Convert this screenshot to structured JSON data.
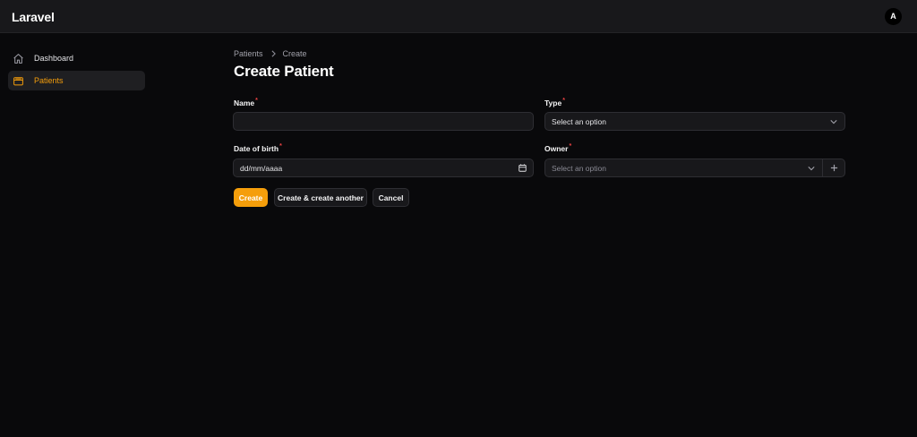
{
  "app": {
    "brand": "Laravel",
    "avatar_initial": "A"
  },
  "sidebar": {
    "items": [
      {
        "label": "Dashboard",
        "icon": "home-icon",
        "active": false
      },
      {
        "label": "Patients",
        "icon": "wallet-icon",
        "active": true
      }
    ]
  },
  "breadcrumb": {
    "parent": "Patients",
    "current": "Create"
  },
  "page": {
    "title": "Create Patient"
  },
  "form": {
    "name": {
      "label": "Name",
      "required_mark": "*",
      "value": ""
    },
    "type": {
      "label": "Type",
      "required_mark": "*",
      "value": "Select an option"
    },
    "date_of_birth": {
      "label": "Date of birth",
      "required_mark": "*",
      "placeholder": "dd/mm/aaaa"
    },
    "owner": {
      "label": "Owner",
      "required_mark": "*",
      "placeholder": "Select an option"
    }
  },
  "actions": {
    "create": "Create",
    "create_another": "Create & create another",
    "cancel": "Cancel"
  },
  "colors": {
    "accent": "#f59e0b",
    "background": "#09090b",
    "topbar": "#18181b",
    "required": "#ef4444"
  }
}
